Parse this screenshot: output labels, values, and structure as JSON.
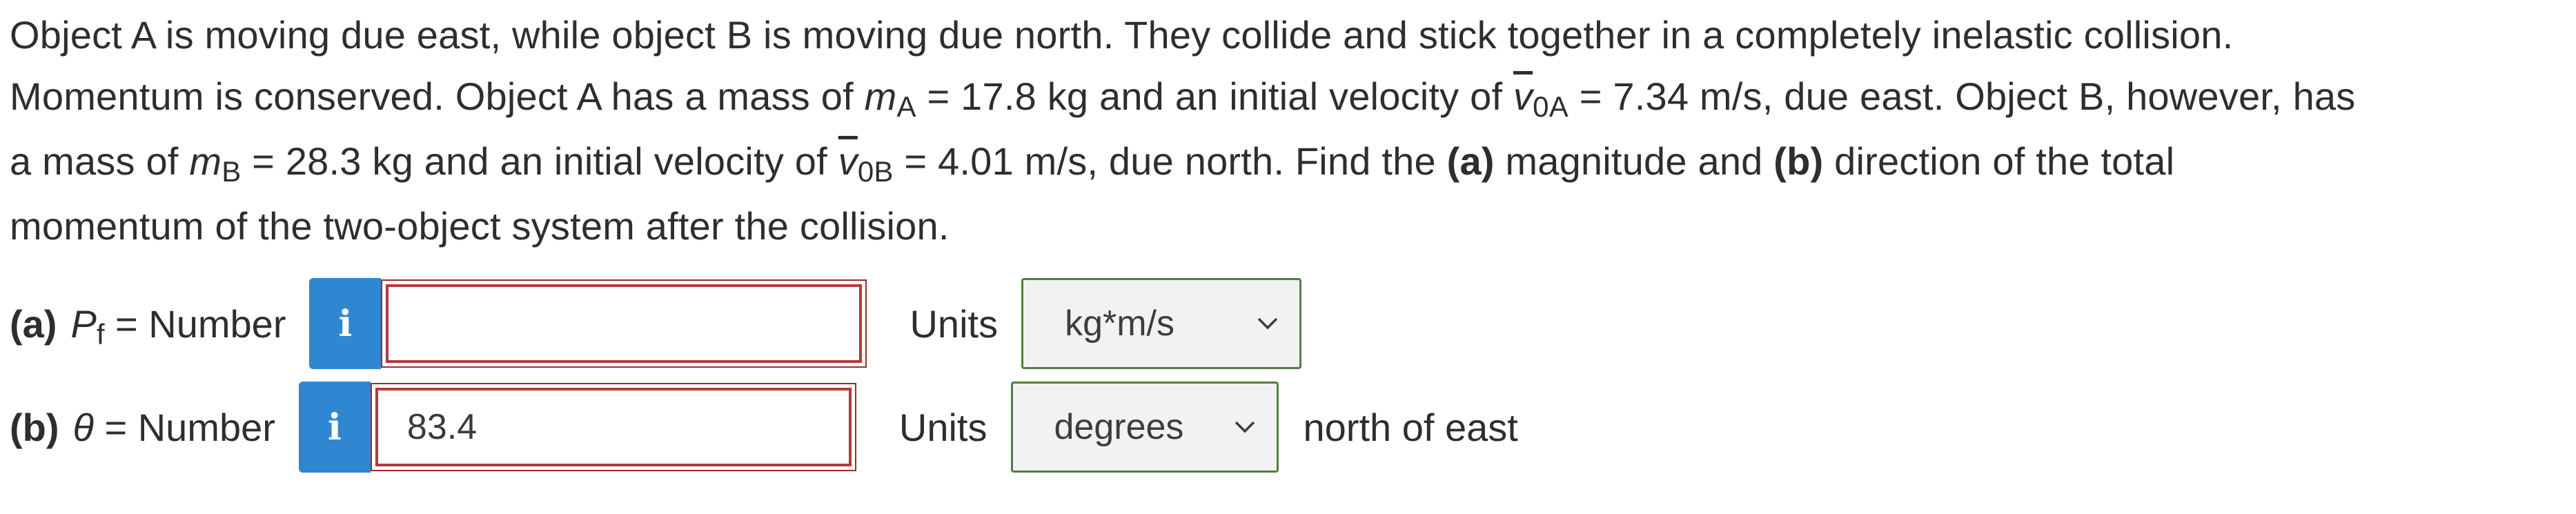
{
  "problem": {
    "line1": "Object A is moving due east, while object B is moving due north. They collide and stick together in a completely inelastic collision.",
    "line2_a": "Momentum is conserved. Object A has a mass of ",
    "mA_sym": "m",
    "mA_sub": "A",
    "line2_b": " = 17.8 kg and an initial velocity of ",
    "v0A_sym": "v",
    "v0A_sub": "0A",
    "line2_c": " = 7.34 m/s, due east. Object B, however, has",
    "line3_a": "a mass of ",
    "mB_sym": "m",
    "mB_sub": "B",
    "line3_b": " = 28.3 kg and an initial velocity of ",
    "v0B_sym": "v",
    "v0B_sub": "0B",
    "line3_c": " = 4.01 m/s, due north. Find the ",
    "part_a": "(a)",
    "line3_d": " magnitude and ",
    "part_b": "(b)",
    "line3_e": " direction of the total",
    "line4": "momentum of the two-object system after the collision."
  },
  "part_a": {
    "label": "(a)",
    "symbol": "P",
    "subscript": "f",
    "eq_text": " = Number",
    "info_glyph": "i",
    "input_value": "",
    "units_label": "Units",
    "unit_selected": "kg*m/s"
  },
  "part_b": {
    "label": "(b)",
    "symbol": "θ",
    "eq_text": " = Number",
    "info_glyph": "i",
    "input_value": "83.4",
    "units_label": "Units",
    "unit_selected": "degrees",
    "suffix": "north of east"
  },
  "colors": {
    "info_button": "#2f87d1",
    "input_border": "#b33a3a",
    "select_border": "#4f7f3f"
  }
}
